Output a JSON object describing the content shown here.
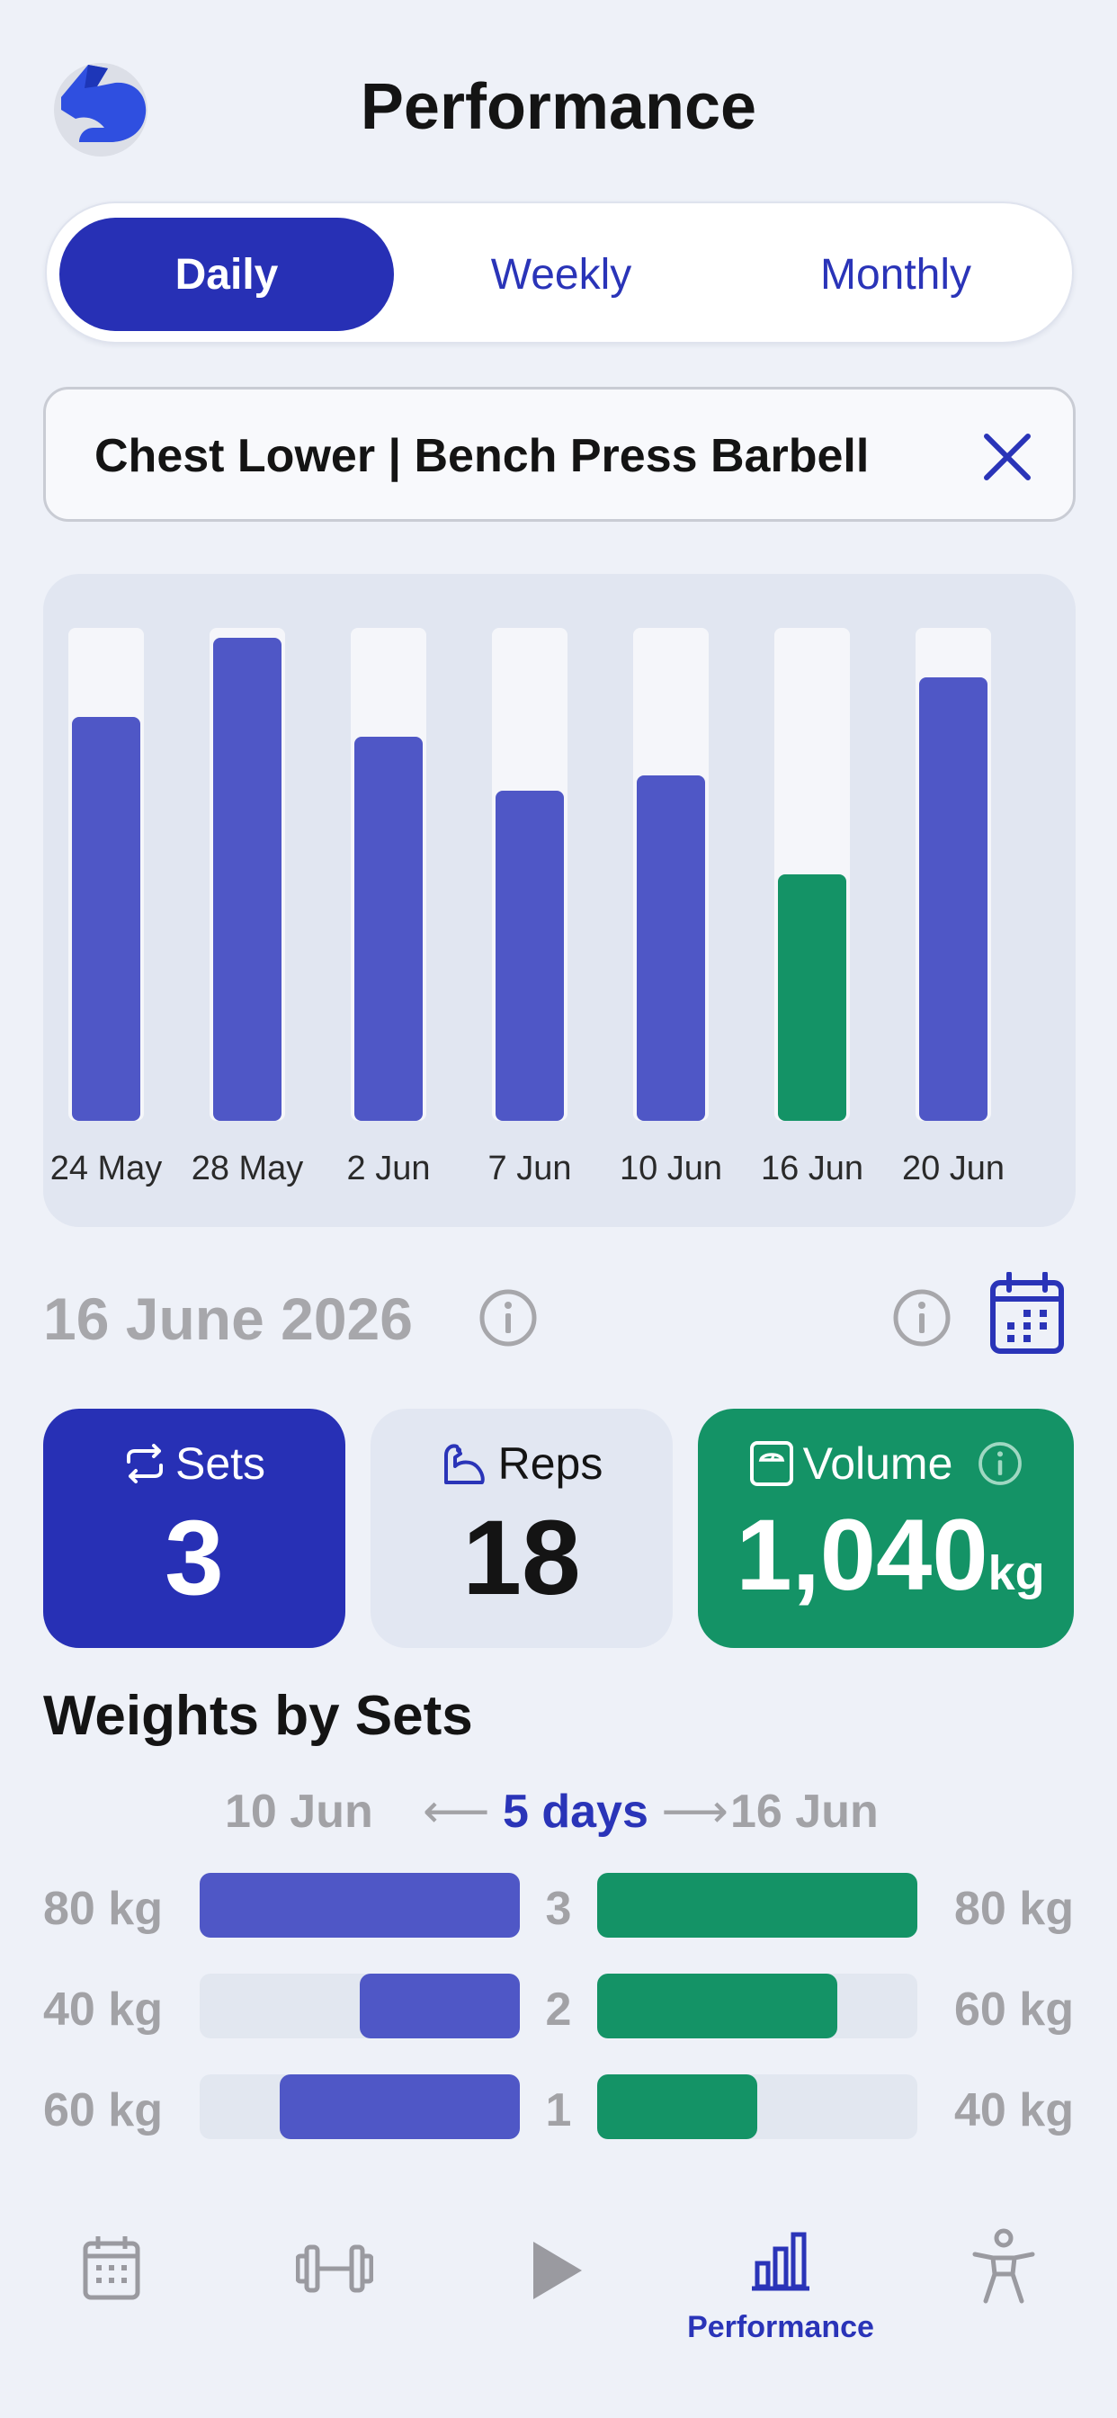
{
  "header": {
    "title": "Performance",
    "logo_icon": "arm-logo-icon"
  },
  "period_tabs": [
    {
      "label": "Daily",
      "active": true
    },
    {
      "label": "Weekly",
      "active": false
    },
    {
      "label": "Monthly",
      "active": false
    }
  ],
  "exercise_filter": {
    "label": "Chest Lower | Bench Press Barbell",
    "clear_icon": "close-icon"
  },
  "chart_data": {
    "type": "bar",
    "categories": [
      "24 May",
      "28 May",
      "2 Jun",
      "7 Jun",
      "10 Jun",
      "16 Jun",
      "20 Jun"
    ],
    "values": [
      0.82,
      0.98,
      0.78,
      0.67,
      0.7,
      0.5,
      0.9
    ],
    "selected_index": 5,
    "colors": {
      "default": "#4f57c6",
      "selected": "#149366",
      "track": "#f5f6fa"
    }
  },
  "selected_day": {
    "date": "16 June 2026",
    "info_icon": "info-icon",
    "calendar_icon": "calendar-icon"
  },
  "stats": {
    "sets": {
      "label": "Sets",
      "value": "3",
      "icon": "repeat-icon",
      "color": "#2730b5"
    },
    "reps": {
      "label": "Reps",
      "value": "18",
      "icon": "flex-arm-icon",
      "color": "#e2e7f2"
    },
    "volume": {
      "label": "Volume",
      "value": "1,040",
      "unit": "kg",
      "icon": "scale-icon",
      "color": "#149366"
    }
  },
  "weights_by_sets": {
    "title": "Weights by Sets",
    "from_date": "10 Jun",
    "gap": "5 days",
    "to_date": "16 Jun",
    "rows": [
      {
        "set": "3",
        "left_kg": "80 kg",
        "left_fill": 1.0,
        "right_kg": "80 kg",
        "right_fill": 1.0
      },
      {
        "set": "2",
        "left_kg": "40 kg",
        "left_fill": 0.5,
        "right_kg": "60 kg",
        "right_fill": 0.75
      },
      {
        "set": "1",
        "left_kg": "60 kg",
        "left_fill": 0.75,
        "right_kg": "40 kg",
        "right_fill": 0.5
      }
    ]
  },
  "bottom_nav": [
    {
      "icon": "calendar-icon",
      "label": ""
    },
    {
      "icon": "dumbbell-icon",
      "label": ""
    },
    {
      "icon": "play-icon",
      "label": ""
    },
    {
      "icon": "bar-chart-icon",
      "label": "Performance",
      "active": true
    },
    {
      "icon": "person-icon",
      "label": ""
    }
  ]
}
